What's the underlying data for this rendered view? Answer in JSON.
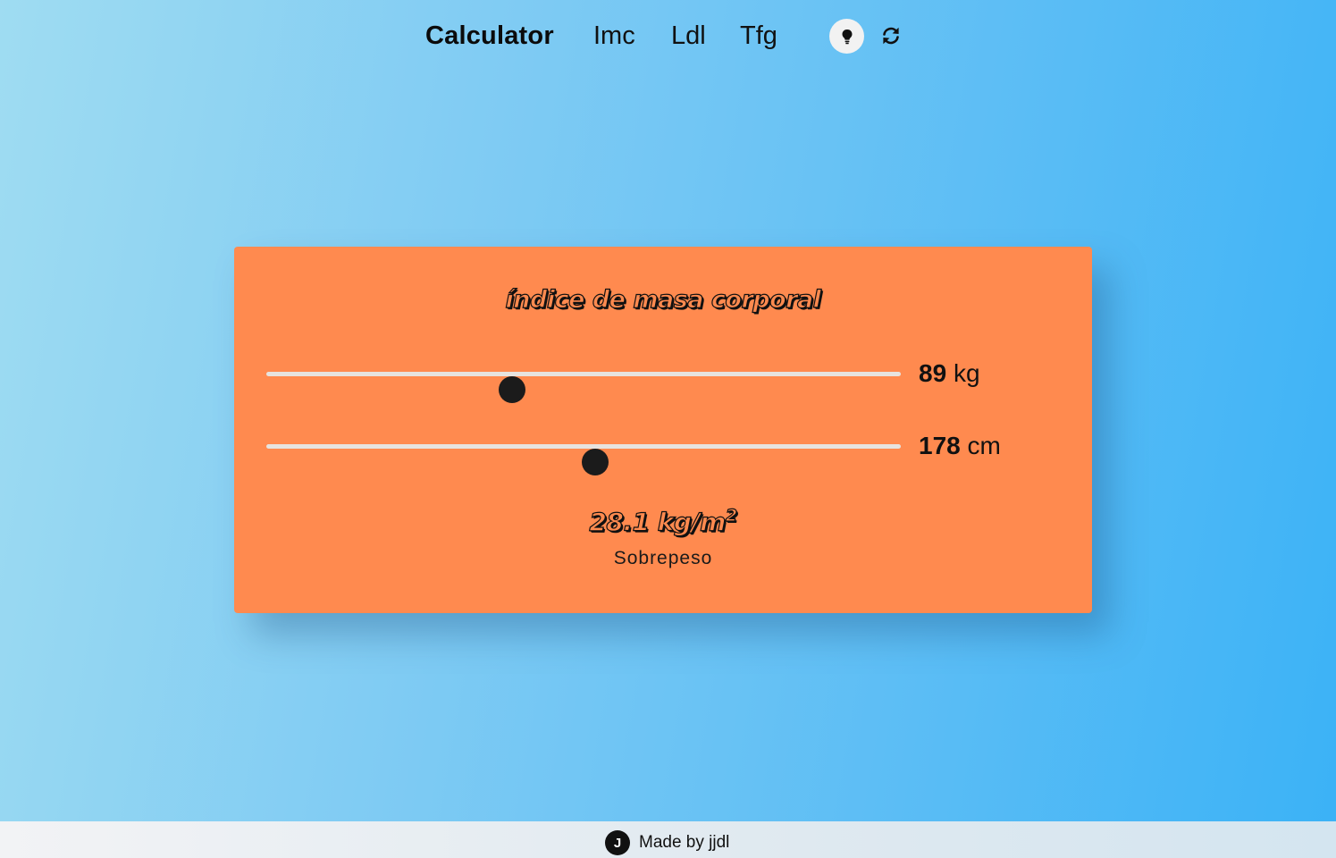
{
  "nav": {
    "brand": "Calculator",
    "links": [
      "Imc",
      "Ldl",
      "Tfg"
    ],
    "theme_icon": "lightbulb-icon",
    "refresh_icon": "refresh-icon"
  },
  "card": {
    "title": "índice de masa corporal",
    "weight": {
      "value": "89",
      "unit": "kg",
      "fraction": 0.387
    },
    "height": {
      "value": "178",
      "unit": "cm",
      "fraction": 0.518
    },
    "result_value": "28.1 kg/m",
    "result_exp": "2",
    "category": "Sobrepeso"
  },
  "footer": {
    "logo_letter": "J",
    "text": "Made by jjdl"
  },
  "colors": {
    "card_bg": "#ff8a4f",
    "thumb": "#1b1b1b",
    "track": "#e7e3df"
  }
}
